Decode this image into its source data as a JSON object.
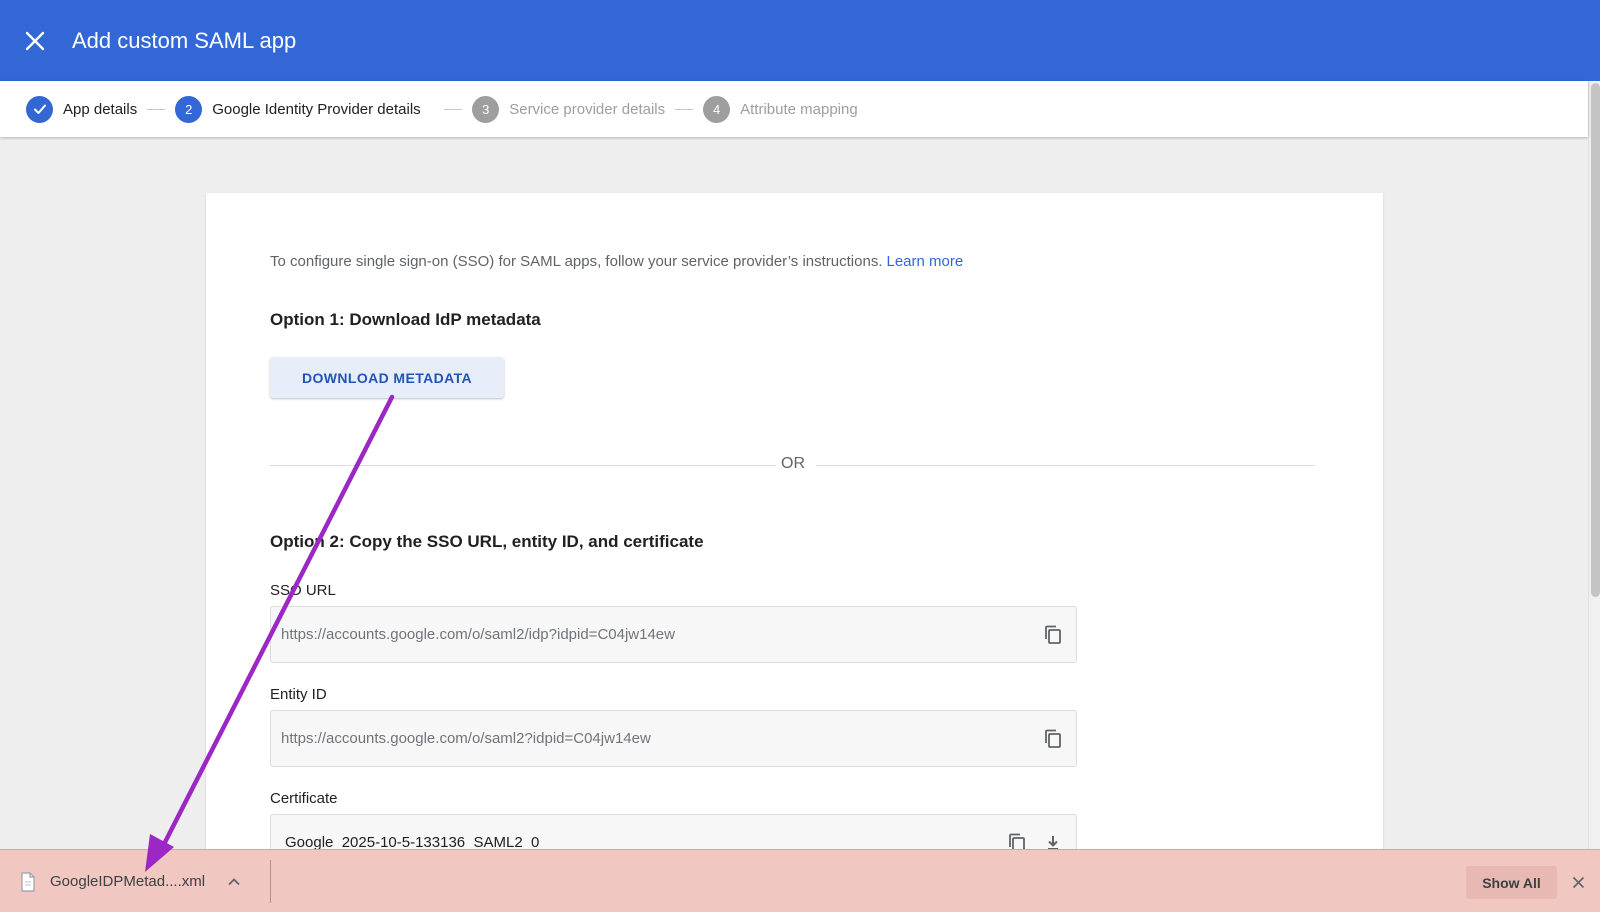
{
  "header": {
    "title": "Add custom SAML app",
    "close_icon": "close-icon",
    "background": "#3367d6"
  },
  "stepper": {
    "steps": [
      {
        "number": "1",
        "label": "App details",
        "state": "done"
      },
      {
        "number": "2",
        "label": "Google Identity Provider details",
        "state": "active"
      },
      {
        "number": "3",
        "label": "Service provider details",
        "state": "pending"
      },
      {
        "number": "4",
        "label": "Attribute mapping",
        "state": "pending"
      }
    ]
  },
  "main": {
    "intro_text": "To configure single sign-on (SSO) for SAML apps, follow your service provider’s instructions.",
    "learn_more": "Learn more",
    "option1_title": "Option 1: Download IdP metadata",
    "download_button": "DOWNLOAD METADATA",
    "or_text": "OR",
    "option2_title": "Option 2: Copy the SSO URL, entity ID, and certificate",
    "sso_url": {
      "label": "SSO URL",
      "value": "https://accounts.google.com/o/saml2/idp?idpid=C04jw14ew"
    },
    "entity_id": {
      "label": "Entity ID",
      "value": "https://accounts.google.com/o/saml2?idpid=C04jw14ew"
    },
    "certificate": {
      "label": "Certificate",
      "value": "Google_2025-10-5-133136_SAML2_0"
    }
  },
  "download_bar": {
    "file_name": "GoogleIDPMetad....xml",
    "show_all": "Show All",
    "background": "#f1c8c1"
  },
  "annotation": {
    "color": "#9b27c4"
  }
}
